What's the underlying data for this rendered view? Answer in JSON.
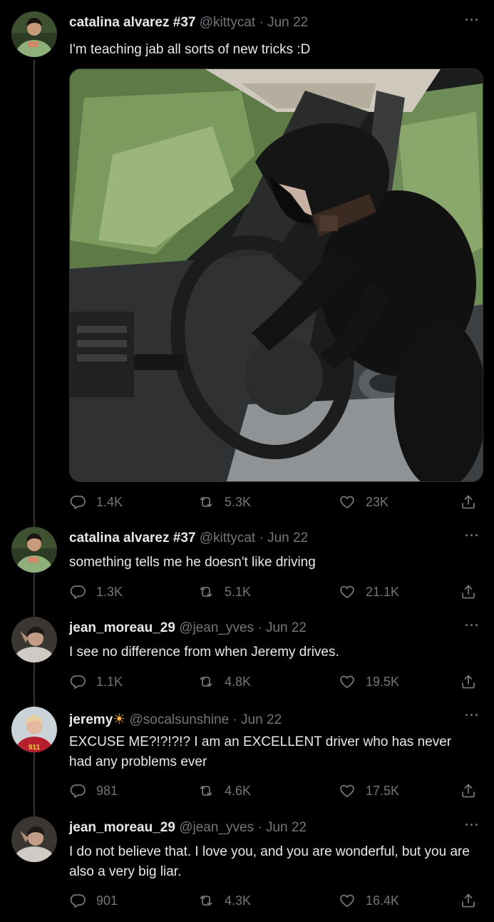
{
  "tweets": [
    {
      "name": "catalina alvarez #37",
      "handle": "@kittycat",
      "date": "Jun 22",
      "text": "I'm teaching jab all sorts of new tricks :D",
      "replies": "1.4K",
      "retweets": "5.3K",
      "likes": "23K"
    },
    {
      "name": "catalina alvarez #37",
      "handle": "@kittycat",
      "date": "Jun 22",
      "text": "something tells me he doesn't like driving",
      "replies": "1.3K",
      "retweets": "5.1K",
      "likes": "21.1K"
    },
    {
      "name": "jean_moreau_29",
      "handle": "@jean_yves",
      "date": "Jun 22",
      "text": "I see no difference from when Jeremy drives.",
      "replies": "1.1K",
      "retweets": "4.8K",
      "likes": "19.5K"
    },
    {
      "name": "jeremy",
      "name_emoji": "☀",
      "handle": "@socalsunshine",
      "date": "Jun 22",
      "text": "EXCUSE ME?!?!?!? I am an EXCELLENT driver who has never had any problems ever",
      "replies": "981",
      "retweets": "4.6K",
      "likes": "17.5K"
    },
    {
      "name": "jean_moreau_29",
      "handle": "@jean_yves",
      "date": "Jun 22",
      "text": "I do not believe that. I love you, and you are wonderful, but you are also a very big liar.",
      "replies": "901",
      "retweets": "4.3K",
      "likes": "16.4K"
    }
  ],
  "separator": "·",
  "more_label": "···",
  "icons": {
    "reply": "reply-icon",
    "retweet": "retweet-icon",
    "like": "heart-icon",
    "share": "share-icon",
    "more": "more-icon"
  },
  "colors": {
    "background": "#000000",
    "text": "#e7e9ea",
    "secondary": "#71767b",
    "thread_line": "#333639"
  }
}
